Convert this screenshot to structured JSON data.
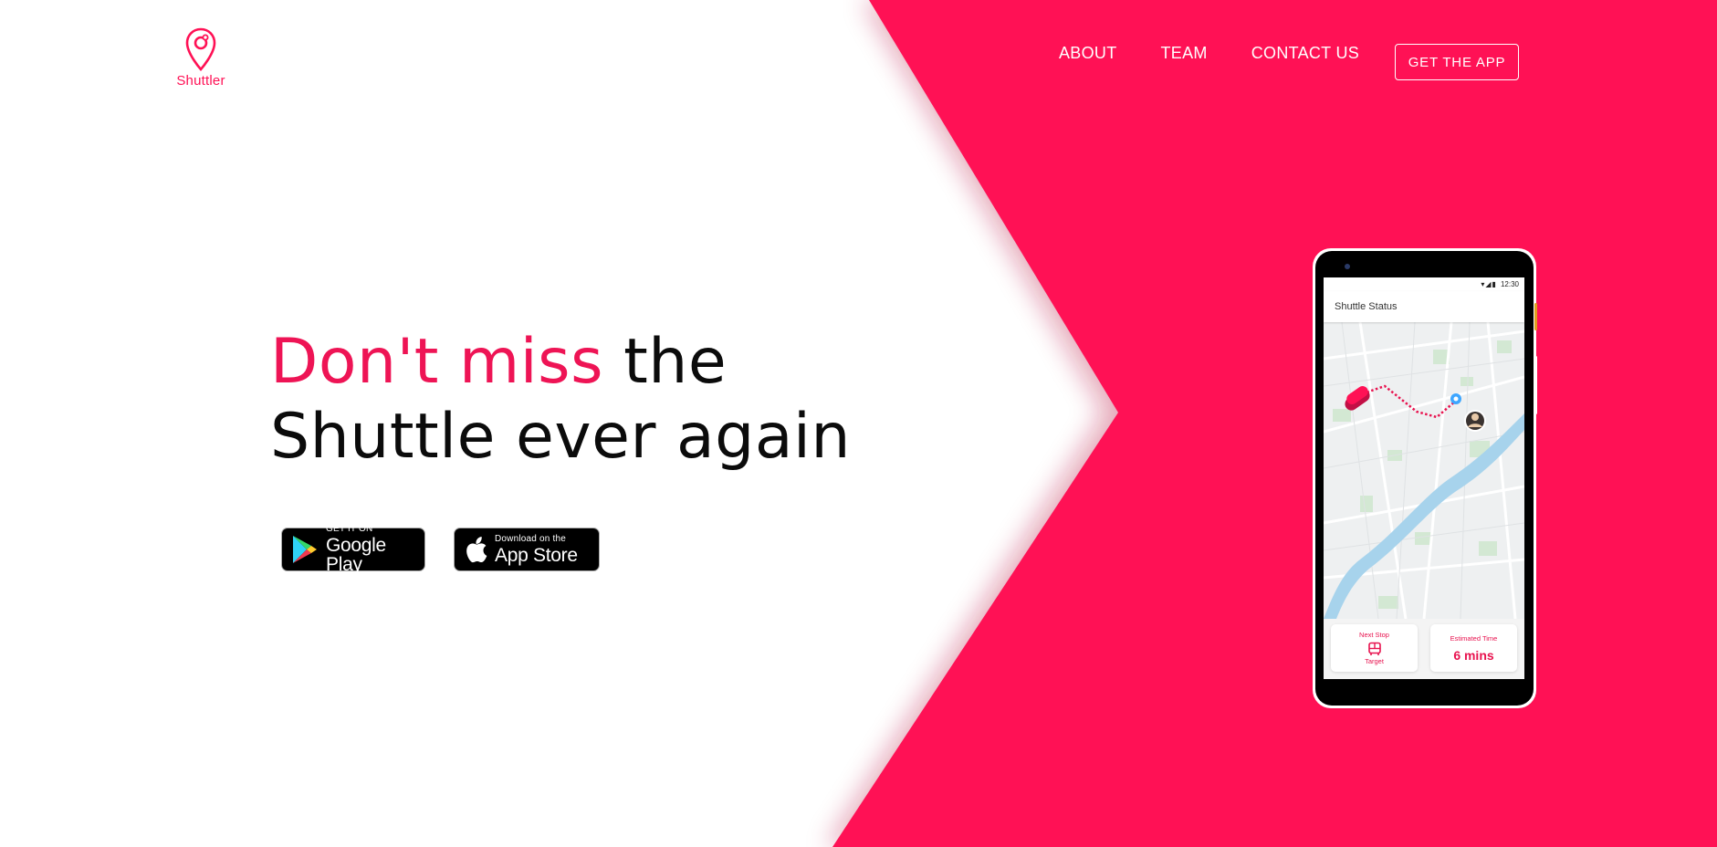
{
  "brand": {
    "name": "Shuttler",
    "accent_color": "#ff1155",
    "logo_icon": "map-pin-icon"
  },
  "nav": {
    "items": [
      {
        "label": "ABOUT"
      },
      {
        "label": "TEAM"
      },
      {
        "label": "CONTACT US"
      }
    ],
    "cta_label": "GET THE APP"
  },
  "hero": {
    "headline_accent": "Don't miss",
    "headline_rest_line1": " the",
    "headline_line2": "Shuttle ever again"
  },
  "badges": {
    "google_play": {
      "small": "GET IT ON",
      "big": "Google Play",
      "icon": "google-play-icon"
    },
    "app_store": {
      "small": "Download on the",
      "big": "App Store",
      "icon": "apple-icon"
    }
  },
  "phone": {
    "status_time": "12:30",
    "app_title": "Shuttle Status",
    "next_stop_label": "Next Stop",
    "next_stop_value": "Target",
    "next_stop_icon": "bus-icon",
    "eta_label": "Estimated Time",
    "eta_value": "6 mins"
  },
  "colors": {
    "background_accent": "#ff1155",
    "headline_accent": "#ee1455",
    "text_dark": "#0b0b0b"
  }
}
